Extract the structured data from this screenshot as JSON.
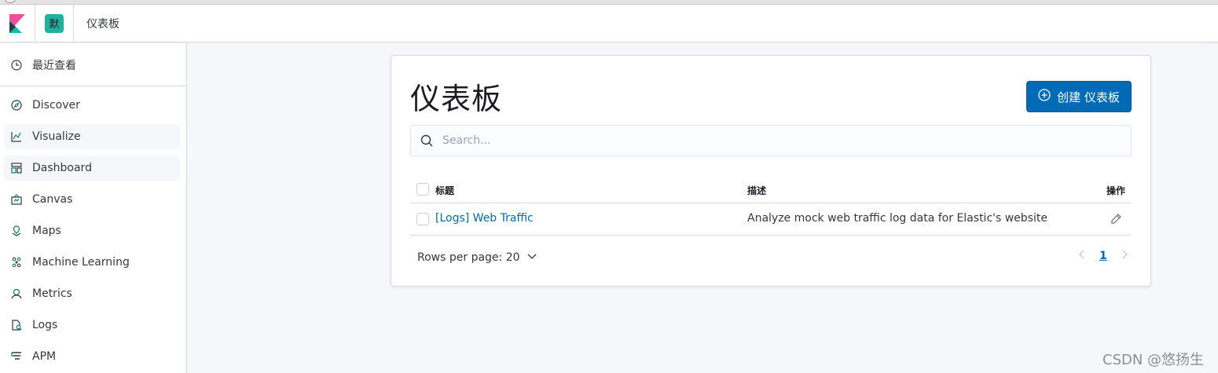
{
  "header": {
    "space_initial": "默",
    "breadcrumb": "仪表板",
    "accent": "#006bb4",
    "space_color": "#20b2a0"
  },
  "sidebar": {
    "recent": {
      "label": "最近查看",
      "icon": "clock-icon"
    },
    "items": [
      {
        "label": "Discover",
        "icon": "compass-icon"
      },
      {
        "label": "Visualize",
        "icon": "visualize-icon"
      },
      {
        "label": "Dashboard",
        "icon": "dashboard-icon"
      },
      {
        "label": "Canvas",
        "icon": "canvas-icon"
      },
      {
        "label": "Maps",
        "icon": "maps-icon"
      },
      {
        "label": "Machine Learning",
        "icon": "ml-icon"
      },
      {
        "label": "Metrics",
        "icon": "metrics-icon"
      },
      {
        "label": "Logs",
        "icon": "logs-icon"
      },
      {
        "label": "APM",
        "icon": "apm-icon"
      }
    ]
  },
  "main": {
    "title": "仪表板",
    "create_button": "创建 仪表板",
    "search_placeholder": "Search...",
    "table": {
      "columns": [
        "标题",
        "描述",
        "操作"
      ],
      "rows": [
        {
          "title": "[Logs] Web Traffic",
          "description": "Analyze mock web traffic log data for Elastic's website"
        }
      ]
    },
    "rows_per_page": "Rows per page: 20",
    "current_page": "1"
  },
  "watermark": "CSDN @悠扬生"
}
